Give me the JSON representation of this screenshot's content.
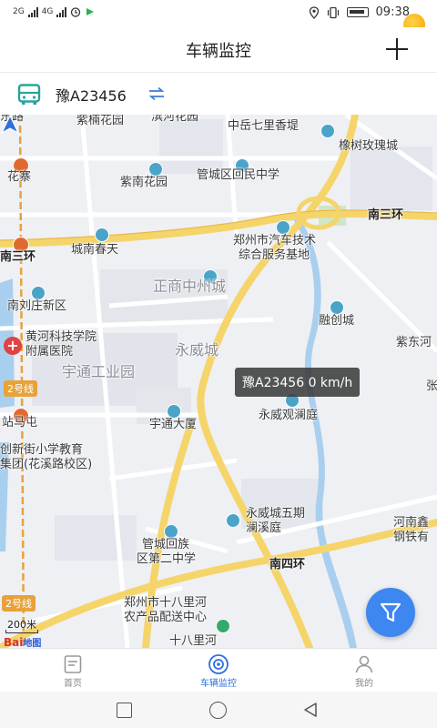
{
  "status_bar": {
    "network_1": "2G",
    "network_2": "4G",
    "time": "09:38"
  },
  "header": {
    "title": "车辆监控",
    "add_icon": "plus-icon"
  },
  "vehicle_bar": {
    "plate": "豫A23456",
    "bus_icon_color": "#2aa39a",
    "swap_icon_color": "#3a7bd5"
  },
  "map": {
    "labels": {
      "l1": "东路",
      "l2": "紫楠花园",
      "l3": "滨河花园",
      "l4": "中岳七里香堤",
      "l5": "橡树玫瑰城",
      "l6": "花寨",
      "l7": "紫南花园",
      "l8": "管城区回民中学",
      "l9": "南三环",
      "l10": "南三环",
      "l11": "城南春天",
      "l12": "郑州市汽车技术",
      "l13": "综合服务基地",
      "l14": "正商中州城",
      "l15": "南刘庄新区",
      "l16": "融创城",
      "l17": "黄河科技学院",
      "l18": "附属医院",
      "l19": "永威城",
      "l20": "紫东河",
      "l21": "宇通工业园",
      "l22": "2号线",
      "l23": "张",
      "l24": "站马屯",
      "l25": "宇通大厦",
      "l26": "永威观澜庭",
      "l27": "创新街小学教育",
      "l28": "集团(花溪路校区)",
      "l29": "永威城五期",
      "l30": "澜溪庭",
      "l31": "河南鑫",
      "l32": "钢铁有",
      "l33": "管城回族",
      "l34": "区第二中学",
      "l35": "南四环",
      "l36": "2号线",
      "l37": "郑州市十八里河",
      "l38": "农产品配送中心",
      "l39": "十八里河"
    },
    "vehicle_callout": "豫A23456  0 km/h",
    "scale": "200米",
    "baidu_logo": "Bai",
    "baidu_logo_cn": "地图",
    "colors": {
      "road_major": "#f5d46a",
      "road_minor": "#ffffff",
      "water": "#a9cfee",
      "green": "#cfe6c8",
      "metro_line": "#e8a23a",
      "accent": "#3e86f0"
    }
  },
  "tabs": [
    {
      "label": "首页",
      "icon": "home-doc-icon",
      "active": false
    },
    {
      "label": "车辆监控",
      "icon": "monitor-icon",
      "active": true
    },
    {
      "label": "我的",
      "icon": "user-icon",
      "active": false
    }
  ]
}
